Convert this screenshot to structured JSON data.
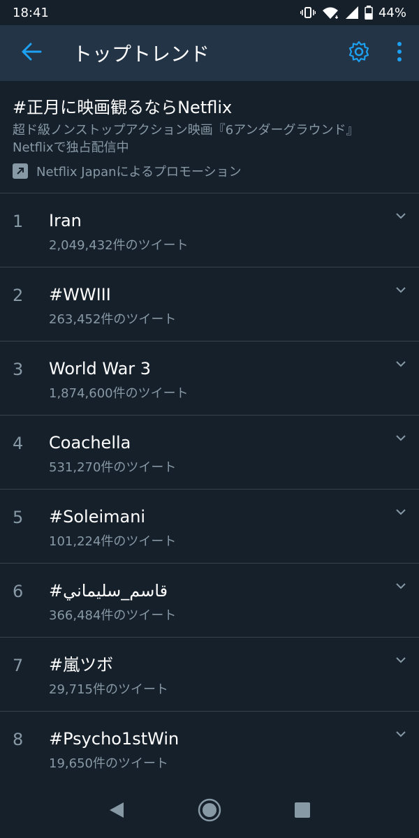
{
  "status_bar": {
    "time": "18:41",
    "battery": "44%",
    "icons": [
      "vibrate-icon",
      "wifi-icon",
      "signal-icon",
      "battery-icon"
    ]
  },
  "app_bar": {
    "title": "トップトレンド",
    "icons": [
      "back-arrow-icon",
      "gear-icon",
      "more-vertical-icon"
    ]
  },
  "promo": {
    "title": "#正月に映画観るならNetflix",
    "desc_line1": "超ド級ノンストップアクション映画『6アンダーグラウンド』",
    "desc_line2": "Netflixで独占配信中",
    "promoted_by": "Netflix Japanによるプロモーション"
  },
  "trends": [
    {
      "rank": "1",
      "name": "Iran",
      "count": "2,049,432件のツイート"
    },
    {
      "rank": "2",
      "name": "#WWIII",
      "count": "263,452件のツイート"
    },
    {
      "rank": "3",
      "name": "World War 3",
      "count": "1,874,600件のツイート"
    },
    {
      "rank": "4",
      "name": "Coachella",
      "count": "531,270件のツイート"
    },
    {
      "rank": "5",
      "name": "#Soleimani",
      "count": "101,224件のツイート"
    },
    {
      "rank": "6",
      "name": "#قاسم_سليماني",
      "count": "366,484件のツイート"
    },
    {
      "rank": "7",
      "name": "#嵐ツボ",
      "count": "29,715件のツイート"
    },
    {
      "rank": "8",
      "name": "#Psycho1stWin",
      "count": "19,650件のツイート"
    }
  ],
  "nav_bar": {
    "icons": [
      "back-triangle-icon",
      "home-circle-icon",
      "recents-square-icon"
    ]
  },
  "colors": {
    "background": "#15202b",
    "app_bar": "#243447",
    "accent": "#1da1f2",
    "secondary_text": "#8899a6",
    "divider": "#38444d"
  }
}
